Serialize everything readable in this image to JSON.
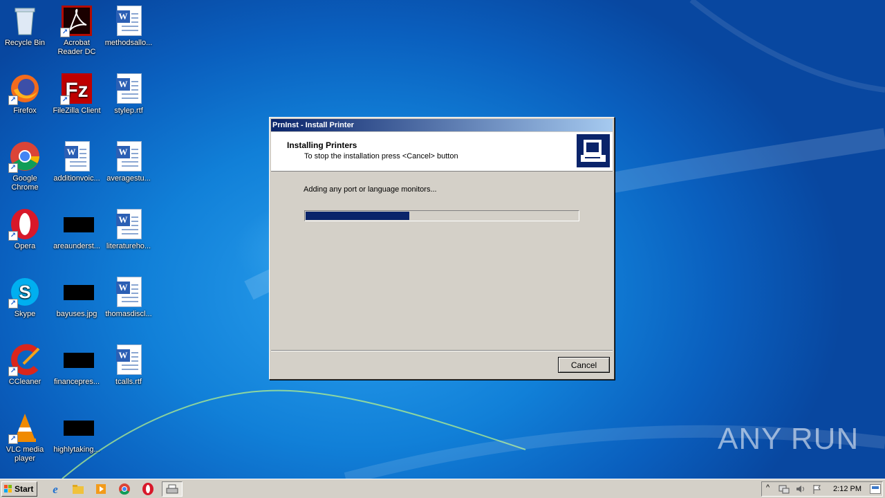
{
  "desktop": {
    "icons": [
      {
        "label": "Recycle Bin",
        "icon": "recycle-bin-icon"
      },
      {
        "label": "Acrobat Reader DC",
        "icon": "acrobat-icon"
      },
      {
        "label": "methodsallo...",
        "icon": "word-doc-icon"
      },
      {
        "label": "Firefox",
        "icon": "firefox-icon"
      },
      {
        "label": "FileZilla Client",
        "icon": "filezilla-icon"
      },
      {
        "label": "stylep.rtf",
        "icon": "word-doc-icon"
      },
      {
        "label": "Google Chrome",
        "icon": "chrome-icon"
      },
      {
        "label": "additionvoic...",
        "icon": "word-doc-icon"
      },
      {
        "label": "averagestu...",
        "icon": "word-doc-icon"
      },
      {
        "label": "Opera",
        "icon": "opera-icon"
      },
      {
        "label": "areaunderst...",
        "icon": "image-file-icon"
      },
      {
        "label": "literatureho...",
        "icon": "word-doc-icon"
      },
      {
        "label": "Skype",
        "icon": "skype-icon"
      },
      {
        "label": "bayuses.jpg",
        "icon": "image-file-icon"
      },
      {
        "label": "thomasdiscl...",
        "icon": "word-doc-icon"
      },
      {
        "label": "CCleaner",
        "icon": "ccleaner-icon"
      },
      {
        "label": "financepres...",
        "icon": "image-file-icon"
      },
      {
        "label": "tcalls.rtf",
        "icon": "word-doc-icon"
      },
      {
        "label": "VLC media player",
        "icon": "vlc-icon"
      },
      {
        "label": "highlytaking...",
        "icon": "image-file-icon"
      }
    ]
  },
  "dialog": {
    "title": "PrnInst - Install Printer",
    "header_title": "Installing Printers",
    "header_subtitle": "To stop the installation press <Cancel> button",
    "status": "Adding any port or language monitors...",
    "progress_fraction": 0.38,
    "cancel_label": "Cancel",
    "accent": "#0a246a"
  },
  "taskbar": {
    "start_label": "Start",
    "clock": "2:12 PM"
  },
  "watermark": "ANY RUN"
}
